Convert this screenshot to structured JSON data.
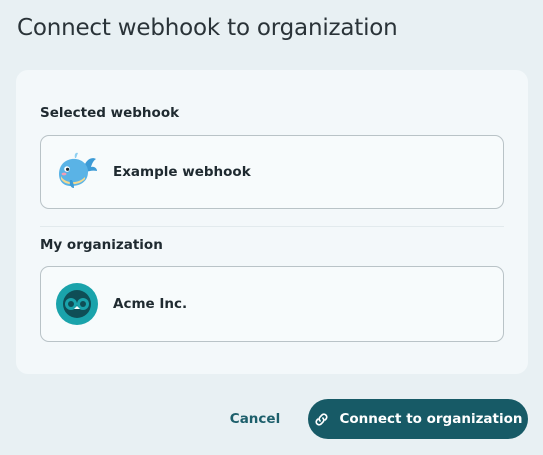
{
  "dialog": {
    "title": "Connect webhook to organization"
  },
  "webhook_section": {
    "label": "Selected webhook",
    "item": {
      "name": "Example webhook",
      "icon": "whale-avatar-icon"
    }
  },
  "organization_section": {
    "label": "My organization",
    "item": {
      "name": "Acme Inc.",
      "icon": "organization-logo-icon"
    }
  },
  "footer": {
    "cancel_label": "Cancel",
    "connect_label": "Connect to organization",
    "connect_icon": "link-icon"
  },
  "colors": {
    "primary": "#175a66",
    "link_text": "#1d5f6b",
    "background": "#e8f0f3",
    "panel": "#f3f8fa",
    "org_logo": "#1aa3ab"
  }
}
